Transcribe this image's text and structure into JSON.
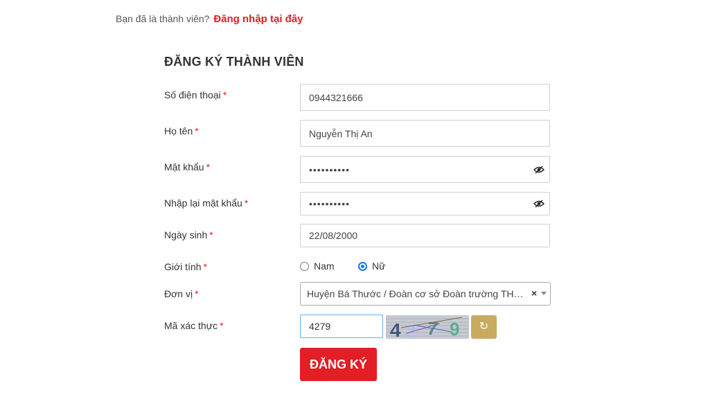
{
  "login_prompt": {
    "text": "Bạn đã là thành viên?",
    "link_label": "Đăng nhập tại đây"
  },
  "form": {
    "title": "ĐĂNG KÝ THÀNH VIÊN",
    "required_mark": "*",
    "phone": {
      "label": "Số điện thoại",
      "value": "0944321666"
    },
    "full_name": {
      "label": "Họ tên",
      "value": "Nguyễn Thị An"
    },
    "password": {
      "label": "Mật khẩu",
      "value": "xxxxxxxxxx",
      "icon": "eye-slash-icon"
    },
    "confirm_password": {
      "label": "Nhập lại mật khẩu",
      "value": "xxxxxxxxxx",
      "icon": "eye-slash-icon"
    },
    "birthday": {
      "label": "Ngày sinh",
      "value": "22/08/2000"
    },
    "gender": {
      "label": "Giới tính",
      "options": [
        {
          "label": "Nam",
          "checked": false
        },
        {
          "label": "Nữ",
          "checked": true
        }
      ]
    },
    "unit": {
      "label": "Đơn vị",
      "selected": "Huyện Bá Thước / Đoàn cơ sở Đoàn trường THPT Hà Văn Mao",
      "clear_glyph": "×"
    },
    "captcha": {
      "label": "Mã xác thực",
      "value": "4279",
      "image_text": "4279",
      "refresh_glyph": "↻"
    },
    "submit_label": "ĐĂNG KÝ"
  },
  "colors": {
    "accent_red": "#e31e24",
    "refresh_gold": "#c9ab5f",
    "radio_blue": "#1a73e8"
  }
}
